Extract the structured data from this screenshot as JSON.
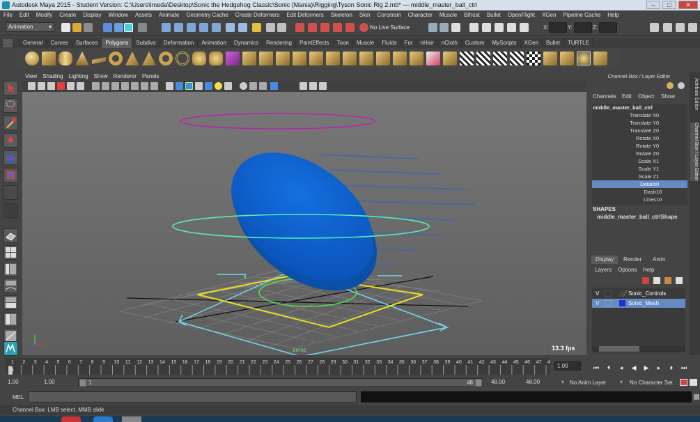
{
  "window": {
    "title": "Autodesk Maya 2015 - Student Version: C:\\Users\\lmeda\\Desktop\\Sonic the Hedgehog Classic\\Sonic (Mania)\\Rigging\\Tyson Sonic Rig 2.mb*  ---  middle_master_ball_ctrl",
    "minimize": "–",
    "maximize": "□",
    "close": "✕"
  },
  "menubar": [
    "File",
    "Edit",
    "Modify",
    "Create",
    "Display",
    "Window",
    "Assets",
    "Animate",
    "Geometry Cache",
    "Create Deformers",
    "Edit Deformers",
    "Skeleton",
    "Skin",
    "Constrain",
    "Character",
    "Muscle",
    "Bifrost",
    "Bullet",
    "OpenFlight",
    "XGen",
    "Pipeline Cache",
    "Help"
  ],
  "status": {
    "mode": "Animation",
    "live_surface": "No Live Surface",
    "x_label": "X:",
    "y_label": "Y:",
    "z_label": "Z:"
  },
  "shelf_tabs": [
    "General",
    "Curves",
    "Surfaces",
    "Polygons",
    "Subdivs",
    "Deformation",
    "Animation",
    "Dynamics",
    "Rendering",
    "PaintEffects",
    "Toon",
    "Muscle",
    "Fluids",
    "Fur",
    "nHair",
    "nCloth",
    "Custom",
    "MyScripts",
    "XGen",
    "Bullet",
    "TURTLE"
  ],
  "shelf_active": "Polygons",
  "viewport": {
    "menu": [
      "View",
      "Shading",
      "Lighting",
      "Show",
      "Renderer",
      "Panels"
    ],
    "camera_label": "persp",
    "fps": "13.3 fps"
  },
  "channel_box": {
    "title": "Channel Box / Layer Editor",
    "menu": [
      "Channels",
      "Edit",
      "Object",
      "Show"
    ],
    "object": "middle_master_ball_ctrl",
    "attributes": [
      {
        "name": "Translate X",
        "value": "0"
      },
      {
        "name": "Translate Y",
        "value": "0"
      },
      {
        "name": "Translate Z",
        "value": "0"
      },
      {
        "name": "Rotate X",
        "value": "0"
      },
      {
        "name": "Rotate Y",
        "value": "0"
      },
      {
        "name": "Rotate Z",
        "value": "0"
      },
      {
        "name": "Scale X",
        "value": "1"
      },
      {
        "name": "Scale Y",
        "value": "1"
      },
      {
        "name": "Scale Z",
        "value": "1"
      },
      {
        "name": "Details",
        "value": "0"
      },
      {
        "name": "Dash",
        "value": "10"
      },
      {
        "name": "Lines",
        "value": "10"
      }
    ],
    "selected_attribute": "Details",
    "shapes_label": "SHAPES",
    "shape_name": "middle_master_ball_ctrlShape"
  },
  "side_tabs": [
    "Attribute Editor",
    "Channel Box / Layer Editor"
  ],
  "layer_editor": {
    "tabs": [
      "Display",
      "Render",
      "Anim"
    ],
    "menu": [
      "Layers",
      "Options",
      "Help"
    ],
    "layers": [
      {
        "v": "V",
        "name": "Sonic_Controls",
        "color": "#444444",
        "selected": false
      },
      {
        "v": "V",
        "name": "Sonic_Mesh",
        "color": "#1f2fd6",
        "selected": true
      }
    ]
  },
  "time_slider": {
    "ticks": [
      "1",
      "2",
      "3",
      "4",
      "5",
      "6",
      "7",
      "8",
      "9",
      "10",
      "11",
      "12",
      "13",
      "14",
      "15",
      "16",
      "17",
      "18",
      "19",
      "20",
      "21",
      "22",
      "23",
      "24",
      "25",
      "26",
      "27",
      "28",
      "29",
      "30",
      "31",
      "32",
      "33",
      "34",
      "35",
      "36",
      "37",
      "38",
      "39",
      "40",
      "41",
      "42",
      "43",
      "44",
      "45",
      "46",
      "47",
      "48"
    ],
    "current_frame": "1",
    "current_field": "1.00"
  },
  "range": {
    "start": "1.00",
    "playback_start": "1.00",
    "slider_left": "1",
    "slider_right": "48",
    "playback_end": "48.00",
    "end": "48.00",
    "anim_layer": "No Anim Layer",
    "character_set": "No Character Set"
  },
  "command": {
    "label": "MEL",
    "help": "Channel Box: LMB select, MMB slide"
  },
  "colors": {
    "ball": "#0d5fcc",
    "ring_top": "#b42aa8",
    "ring_mid": "#58ecb8",
    "ring_inner": "#4fe04f",
    "square": "#e8e020",
    "arrows": "#73d8f0",
    "selection": "#678ac2"
  }
}
